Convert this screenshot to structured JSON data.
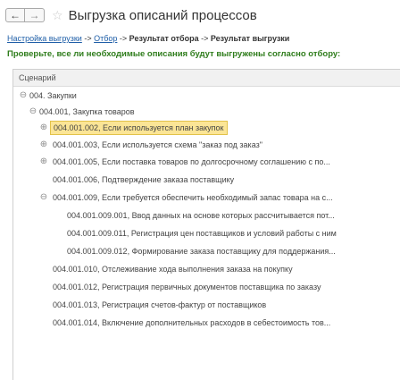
{
  "window": {
    "title": "Выгрузка описаний процессов",
    "back_icon": "←",
    "forward_icon": "→",
    "star_icon": "☆"
  },
  "breadcrumbs": {
    "item1": "Настройка выгрузки",
    "sep1": " -> ",
    "item2": "Отбор",
    "sep2": " -> ",
    "item3": "Результат отбора",
    "sep3": " -> ",
    "item4": "Результат выгрузки"
  },
  "notice": "Проверьте, все ли необходимые описания будут выгружены согласно отбору:",
  "tree": {
    "column_header": "Сценарий",
    "rows": [
      {
        "text": "004. Закупки",
        "toggle": "⊖"
      },
      {
        "text": "004.001, Закупка товаров",
        "toggle": "⊖"
      },
      {
        "text": "004.001.002, Если используется план закупок",
        "toggle": "⊕"
      },
      {
        "text": "004.001.003, Если используется схема \"заказ под заказ\"",
        "toggle": "⊕"
      },
      {
        "text": "004.001.005, Если поставка товаров по долгосрочному соглашению с по...",
        "toggle": "⊕"
      },
      {
        "text": "004.001.006, Подтверждение заказа поставщику",
        "toggle": ""
      },
      {
        "text": "004.001.009, Если требуется обеспечить необходимый запас товара на с...",
        "toggle": "⊖"
      },
      {
        "text": "004.001.009.001, Ввод данных на основе которых рассчитывается пот...",
        "toggle": ""
      },
      {
        "text": "004.001.009.011, Регистрация цен поставщиков и условий работы с ним",
        "toggle": ""
      },
      {
        "text": "004.001.009.012, Формирование заказа поставщику для поддержания...",
        "toggle": ""
      },
      {
        "text": "004.001.010, Отслеживание хода выполнения заказа на покупку",
        "toggle": ""
      },
      {
        "text": "004.001.012, Регистрация первичных документов поставщика по заказу",
        "toggle": ""
      },
      {
        "text": "004.001.013, Регистрация счетов-фактур от поставщиков",
        "toggle": ""
      },
      {
        "text": "004.001.014, Включение дополнительных расходов в себестоимость тов...",
        "toggle": ""
      }
    ]
  }
}
